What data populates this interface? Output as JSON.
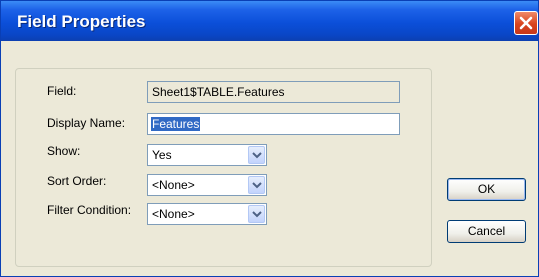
{
  "window": {
    "title": "Field Properties"
  },
  "form": {
    "field_label": "Field:",
    "field_value": "Sheet1$TABLE.Features",
    "display_name_label": "Display Name:",
    "display_name_value": "Features",
    "show_label": "Show:",
    "show_value": "Yes",
    "sort_order_label": "Sort Order:",
    "sort_order_value": "<None>",
    "filter_condition_label": "Filter Condition:",
    "filter_condition_value": "<None>"
  },
  "buttons": {
    "ok_label": "OK",
    "cancel_label": "Cancel"
  },
  "icons": {
    "close": "close-icon",
    "dropdown": "chevron-down-icon"
  },
  "colors": {
    "titlebar": "#0a4fd9",
    "close_button": "#d8441e",
    "selection": "#316ac5",
    "dialog_bg": "#ece9d8"
  }
}
